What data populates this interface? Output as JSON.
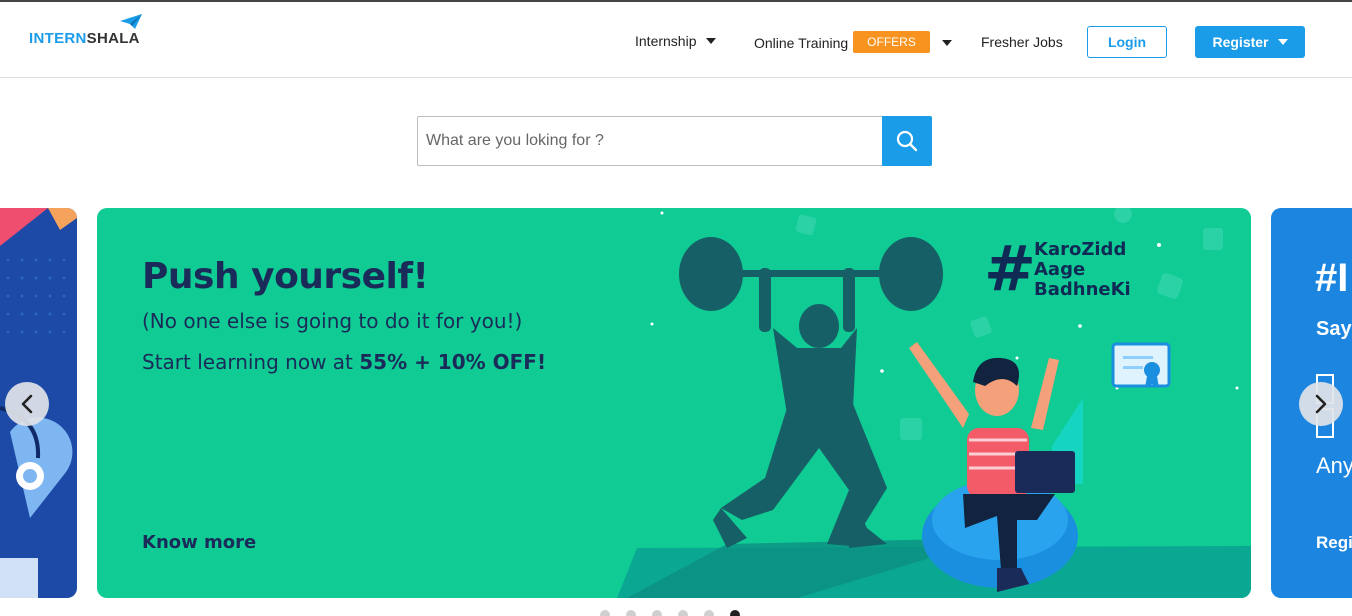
{
  "brand": {
    "logo_part1": "INTERN",
    "logo_part2": "SHALA",
    "logo_icon": "paper-plane-icon"
  },
  "nav": {
    "internship": "Internship",
    "online_training": "Online Training",
    "offers_badge": "OFFERS",
    "fresher_jobs": "Fresher Jobs",
    "login": "Login",
    "register": "Register"
  },
  "search": {
    "placeholder": "What are you loking for ?",
    "icon": "search-icon"
  },
  "carousel": {
    "main_slide": {
      "headline": "Push yourself!",
      "subline": "(No one else is going to do it for you!)",
      "offer_prefix": "Start learning now at ",
      "offer_bold": "55% + 10% OFF!",
      "hashtag_symbol": "#",
      "hashtag_line1": "KaroZidd",
      "hashtag_line2": "Aage",
      "hashtag_line3": "BadhneKi",
      "cta": "Know more"
    },
    "right_slide": {
      "text1": "#I",
      "text2": "Say",
      "text3": "Any",
      "text4": "Regi"
    },
    "dot_count": 6,
    "active_dot": 5,
    "prev_icon": "chevron-left-icon",
    "next_icon": "chevron-right-icon"
  },
  "colors": {
    "brand_blue": "#1b9ce8",
    "offers_orange": "#f7931e",
    "slide_green": "#10cb94",
    "headline_navy": "#1a2b59"
  }
}
